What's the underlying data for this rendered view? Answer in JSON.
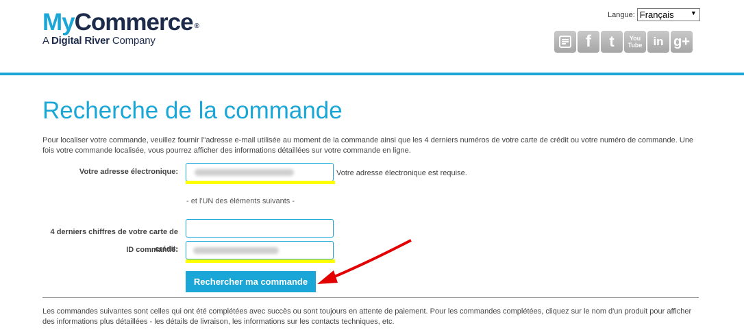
{
  "header": {
    "logo_my": "My",
    "logo_commerce": "Commerce",
    "logo_registered": "®",
    "logo_sub_prefix": "A ",
    "logo_sub_bold": "Digital River",
    "logo_sub_suffix": " Company",
    "language_label": "Langue:",
    "language_value": "Français",
    "social_icons": [
      "blog-icon",
      "facebook-icon",
      "twitter-icon",
      "youtube-icon",
      "linkedin-icon",
      "google-plus-icon"
    ],
    "accent_color": "#1aa6d6"
  },
  "main": {
    "title": "Recherche de la commande",
    "intro": "Pour localiser votre commande, veuillez fournir l''adresse e-mail utilisée au moment de la commande ainsi que les 4 derniers numéros de votre carte de crédit ou votre numéro de commande. Une fois votre commande localisée, vous pourrez afficher des informations détaillées sur votre commande en ligne.",
    "email_label": "Votre adresse électronique:",
    "email_hint": "Votre adresse électronique est requise.",
    "or_text": "- et l'UN des éléments suivants -",
    "card_label": "4 derniers chiffres de votre carte de crédit:",
    "order_label": "ID commande:",
    "search_button": "Rechercher ma commande",
    "footer_note": "Les commandes suivantes sont celles qui ont été complétées avec succès ou sont toujours en attente de paiement. Pour les commandes complétées, cliquez sur le nom d'un produit pour afficher des informations plus détaillées - les détails de livraison, les informations sur les contacts techniques, etc."
  }
}
